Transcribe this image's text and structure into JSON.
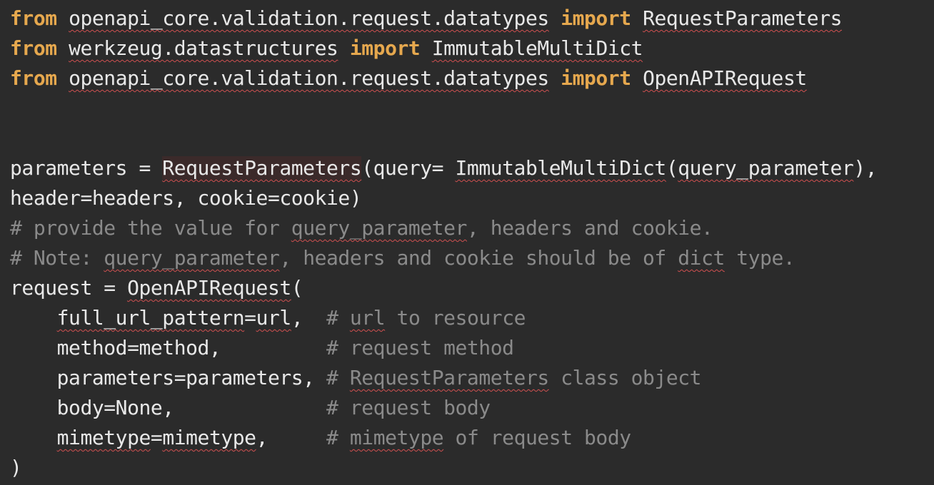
{
  "editor": {
    "lines": [
      {
        "parts": [
          {
            "t": "from",
            "c": "kw"
          },
          {
            "t": " "
          },
          {
            "t": "openapi_core.validation.request.datatypes",
            "c": "sq"
          },
          {
            "t": " "
          },
          {
            "t": "import",
            "c": "kw"
          },
          {
            "t": " "
          },
          {
            "t": "RequestParameters",
            "c": "sq"
          }
        ]
      },
      {
        "parts": [
          {
            "t": "from",
            "c": "kw"
          },
          {
            "t": " "
          },
          {
            "t": "werkzeug.datastructures",
            "c": "sq"
          },
          {
            "t": " "
          },
          {
            "t": "import",
            "c": "kw"
          },
          {
            "t": " "
          },
          {
            "t": "ImmutableMultiDict",
            "c": "sq"
          }
        ]
      },
      {
        "parts": [
          {
            "t": "from",
            "c": "kw"
          },
          {
            "t": " "
          },
          {
            "t": "openapi_core.validation.request.datatypes",
            "c": "sq"
          },
          {
            "t": " "
          },
          {
            "t": "import",
            "c": "kw"
          },
          {
            "t": " "
          },
          {
            "t": "OpenAPIRequest",
            "c": "sq"
          }
        ]
      },
      {
        "parts": []
      },
      {
        "parts": []
      },
      {
        "parts": [
          {
            "t": "parameters = "
          },
          {
            "t": "RequestParameters",
            "c": "sq hl"
          },
          {
            "t": "(query= "
          },
          {
            "t": "ImmutableMultiDict",
            "c": "sq"
          },
          {
            "t": "("
          },
          {
            "t": "query_parameter",
            "c": "sq"
          },
          {
            "t": "),"
          }
        ]
      },
      {
        "parts": [
          {
            "t": "header=headers, cookie=cookie)"
          }
        ]
      },
      {
        "parts": [
          {
            "t": "# provide the value for ",
            "c": "cm"
          },
          {
            "t": "query_parameter",
            "c": "cm sq"
          },
          {
            "t": ", headers and cookie.",
            "c": "cm"
          }
        ]
      },
      {
        "parts": [
          {
            "t": "# Note: ",
            "c": "cm"
          },
          {
            "t": "query_parameter",
            "c": "cm sq"
          },
          {
            "t": ", headers and cookie should be of ",
            "c": "cm"
          },
          {
            "t": "dict",
            "c": "cm sq"
          },
          {
            "t": " type.",
            "c": "cm"
          }
        ]
      },
      {
        "parts": [
          {
            "t": "request = "
          },
          {
            "t": "OpenAPIRequest",
            "c": "sq"
          },
          {
            "t": "("
          }
        ]
      },
      {
        "parts": [
          {
            "t": "    "
          },
          {
            "t": "full_url_pattern",
            "c": "sq"
          },
          {
            "t": "="
          },
          {
            "t": "url",
            "c": "sq"
          },
          {
            "t": ",  "
          },
          {
            "t": "# ",
            "c": "cm"
          },
          {
            "t": "url",
            "c": "cm sq"
          },
          {
            "t": " to resource",
            "c": "cm"
          }
        ]
      },
      {
        "parts": [
          {
            "t": "    method=method,         "
          },
          {
            "t": "# request method",
            "c": "cm"
          }
        ]
      },
      {
        "parts": [
          {
            "t": "    parameters=parameters, "
          },
          {
            "t": "# ",
            "c": "cm"
          },
          {
            "t": "RequestParameters",
            "c": "cm sq"
          },
          {
            "t": " class object",
            "c": "cm"
          }
        ]
      },
      {
        "parts": [
          {
            "t": "    body=None,             "
          },
          {
            "t": "# request body",
            "c": "cm"
          }
        ]
      },
      {
        "parts": [
          {
            "t": "    "
          },
          {
            "t": "mimetype",
            "c": "sq"
          },
          {
            "t": "="
          },
          {
            "t": "mimetype",
            "c": "sq"
          },
          {
            "t": ",     "
          },
          {
            "t": "# ",
            "c": "cm"
          },
          {
            "t": "mimetype",
            "c": "cm sq"
          },
          {
            "t": " of request body",
            "c": "cm"
          }
        ]
      },
      {
        "parts": [
          {
            "t": ")"
          }
        ]
      }
    ]
  }
}
